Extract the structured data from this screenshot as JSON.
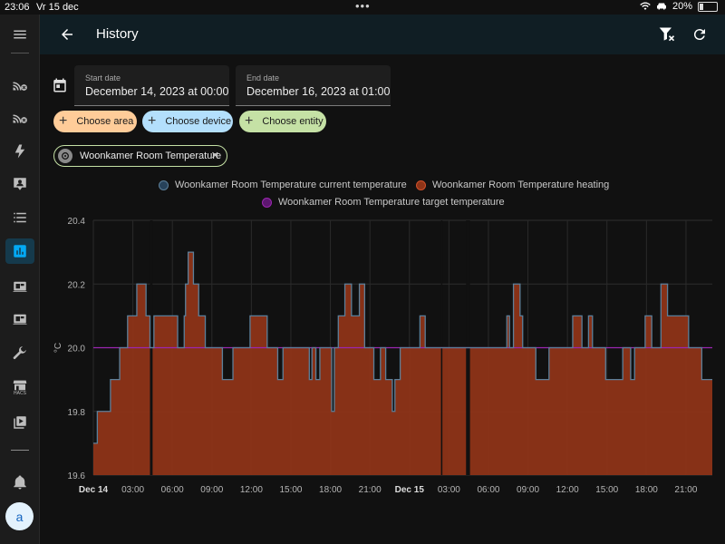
{
  "status_bar": {
    "time": "23:06",
    "date": "Vr 15 dec",
    "battery": "20%"
  },
  "header": {
    "title": "History"
  },
  "date_range": {
    "start_label": "Start date",
    "start_value": "December 14, 2023 at 00:00",
    "end_label": "End date",
    "end_value": "December 16, 2023 at 01:00"
  },
  "target_chips": [
    {
      "label": "Choose area",
      "color": "#ffcc99"
    },
    {
      "label": "Choose device",
      "color": "#b3dffc"
    },
    {
      "label": "Choose entity",
      "color": "#c5e1a5"
    }
  ],
  "selected_entity": {
    "label": "Woonkamer Room Temperature"
  },
  "sidebar": {
    "avatar_letter": "a",
    "hacs_label": "HACS"
  },
  "colors": {
    "accent": "#03a9f4",
    "heating": "#8e3418",
    "heating_border": "#d1502a",
    "current": "#5c7f99",
    "target": "#9b27b0"
  },
  "chart_data": {
    "type": "area",
    "ylabel": "°C",
    "ylim": [
      19.6,
      20.4
    ],
    "yticks": [
      "19.6",
      "19.8",
      "20.0",
      "20.2",
      "20.4"
    ],
    "x_range_hours": [
      0,
      47
    ],
    "xticks": [
      {
        "h": 0,
        "label": "Dec 14",
        "bold": true
      },
      {
        "h": 3,
        "label": "03:00"
      },
      {
        "h": 6,
        "label": "06:00"
      },
      {
        "h": 9,
        "label": "09:00"
      },
      {
        "h": 12,
        "label": "12:00"
      },
      {
        "h": 15,
        "label": "15:00"
      },
      {
        "h": 18,
        "label": "18:00"
      },
      {
        "h": 21,
        "label": "21:00"
      },
      {
        "h": 24,
        "label": "Dec 15",
        "bold": true
      },
      {
        "h": 27,
        "label": "03:00"
      },
      {
        "h": 30,
        "label": "06:00"
      },
      {
        "h": 33,
        "label": "09:00"
      },
      {
        "h": 36,
        "label": "12:00"
      },
      {
        "h": 39,
        "label": "15:00"
      },
      {
        "h": 42,
        "label": "18:00"
      },
      {
        "h": 45,
        "label": "21:00"
      }
    ],
    "legend": [
      "Woonkamer Room Temperature current temperature",
      "Woonkamer Room Temperature heating",
      "Woonkamer Room Temperature target temperature"
    ],
    "target_value": 20.0,
    "heating_gaps": [
      [
        4.3,
        4.5
      ],
      [
        26.4,
        26.5
      ],
      [
        28.3,
        28.6
      ]
    ],
    "current_temperature": [
      [
        0,
        19.7
      ],
      [
        0.3,
        19.8
      ],
      [
        1.3,
        19.9
      ],
      [
        2.0,
        20.0
      ],
      [
        2.6,
        20.1
      ],
      [
        3.3,
        20.2
      ],
      [
        4.0,
        20.1
      ],
      [
        4.3,
        20.0
      ],
      [
        4.6,
        20.1
      ],
      [
        6.4,
        20.0
      ],
      [
        6.9,
        20.1
      ],
      [
        7.0,
        20.2
      ],
      [
        7.2,
        20.3
      ],
      [
        7.6,
        20.2
      ],
      [
        8.0,
        20.1
      ],
      [
        8.5,
        20.0
      ],
      [
        9.8,
        19.9
      ],
      [
        10.6,
        20.0
      ],
      [
        11.9,
        20.1
      ],
      [
        13.2,
        20.0
      ],
      [
        14.0,
        19.9
      ],
      [
        14.4,
        20.0
      ],
      [
        16.4,
        19.9
      ],
      [
        16.6,
        20.0
      ],
      [
        16.9,
        19.9
      ],
      [
        17.2,
        20.0
      ],
      [
        18.1,
        19.8
      ],
      [
        18.3,
        20.0
      ],
      [
        18.6,
        20.1
      ],
      [
        19.1,
        20.2
      ],
      [
        19.6,
        20.1
      ],
      [
        20.2,
        20.2
      ],
      [
        20.6,
        20.0
      ],
      [
        21.3,
        19.9
      ],
      [
        21.8,
        20.0
      ],
      [
        22.2,
        19.9
      ],
      [
        22.7,
        19.8
      ],
      [
        22.9,
        19.9
      ],
      [
        23.3,
        20.0
      ],
      [
        24.8,
        20.1
      ],
      [
        25.2,
        20.0
      ],
      [
        31.4,
        20.1
      ],
      [
        31.6,
        20.0
      ],
      [
        31.9,
        20.2
      ],
      [
        32.4,
        20.1
      ],
      [
        32.6,
        20.0
      ],
      [
        33.6,
        19.9
      ],
      [
        34.6,
        20.0
      ],
      [
        36.4,
        20.1
      ],
      [
        37.1,
        20.0
      ],
      [
        37.6,
        20.1
      ],
      [
        37.9,
        20.0
      ],
      [
        38.9,
        19.9
      ],
      [
        40.2,
        20.0
      ],
      [
        40.8,
        19.9
      ],
      [
        41.1,
        20.0
      ],
      [
        41.9,
        20.1
      ],
      [
        42.4,
        20.0
      ],
      [
        43.1,
        20.2
      ],
      [
        43.6,
        20.1
      ],
      [
        45.2,
        20.0
      ],
      [
        46.2,
        19.9
      ],
      [
        47.0,
        19.9
      ]
    ]
  }
}
